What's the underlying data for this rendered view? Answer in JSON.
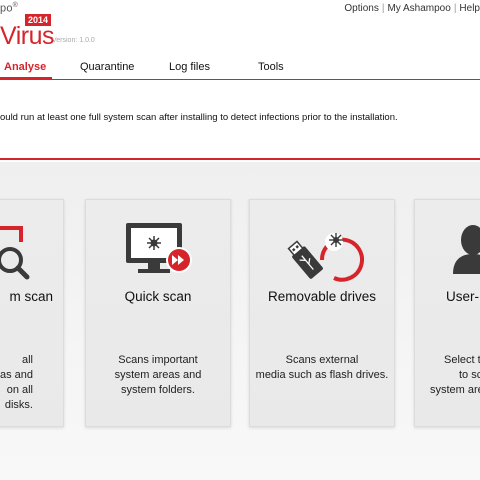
{
  "app": {
    "logo_top": "po",
    "logo_reg": "®",
    "logo_year": "2014",
    "logo_main": "Virus",
    "version": "Version: 1.0.0"
  },
  "toplinks": {
    "options": "Options",
    "my_ashampoo": "My Ashampoo",
    "help": "Help",
    "separator": "|"
  },
  "tabs": [
    {
      "label": "Analyse",
      "active": true
    },
    {
      "label": "Quarantine",
      "active": false
    },
    {
      "label": "Log files",
      "active": false
    },
    {
      "label": "Tools",
      "active": false
    }
  ],
  "info": {
    "text": "ould run at least one full system scan after installing to detect infections prior to the installation."
  },
  "cards": [
    {
      "title": "m scan",
      "icon": "magnifier-icon",
      "desc": [
        "all",
        "eas and",
        "on all",
        "disks."
      ]
    },
    {
      "title": "Quick scan",
      "icon": "monitor-virus-icon",
      "desc": [
        "Scans important",
        "system areas and",
        "system folders."
      ]
    },
    {
      "title": "Removable drives",
      "icon": "usb-drive-icon",
      "desc": [
        "Scans external",
        "media such as flash drives."
      ]
    },
    {
      "title": "User-",
      "icon": "user-icon",
      "desc": [
        "Select t",
        "to sc",
        "system are"
      ]
    }
  ],
  "colors": {
    "accent": "#d6242b",
    "card_bg": "#ececec",
    "icon_dark": "#3a3a3a"
  }
}
